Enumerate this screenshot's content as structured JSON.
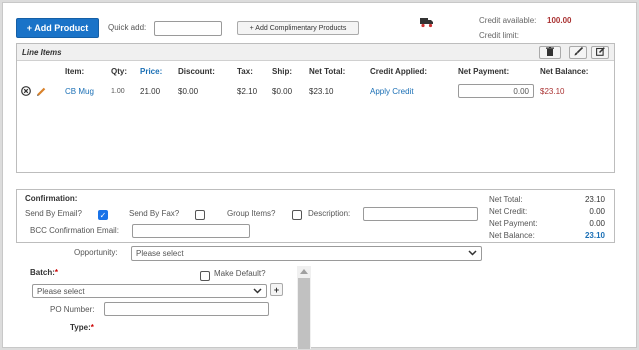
{
  "toolbar": {
    "add_product_label": "+ Add Product",
    "quick_add_label": "Quick add:",
    "quick_add_value": "",
    "add_complimentary_label": "+ Add Complimentary Products"
  },
  "credit": {
    "available_label": "Credit available:",
    "available_value": "100.00",
    "limit_label": "Credit limit:",
    "limit_value": ""
  },
  "line_items": {
    "title": "Line Items",
    "columns": [
      "Item:",
      "Qty:",
      "Price:",
      "Discount:",
      "Tax:",
      "Ship:",
      "Net Total:",
      "Credit Applied:",
      "Net Payment:",
      "Net Balance:"
    ],
    "rows": [
      {
        "item": "CB Mug",
        "qty": "1.00",
        "price": "21.00",
        "discount": "$0.00",
        "tax": "$2.10",
        "ship": "$0.00",
        "net_total": "$23.10",
        "credit_applied": "Apply Credit",
        "net_payment": "0.00",
        "net_balance": "$23.10"
      }
    ]
  },
  "confirmation": {
    "title": "Confirmation:",
    "send_email_label": "Send By Email?",
    "send_email_checked": true,
    "send_fax_label": "Send By Fax?",
    "send_fax_checked": false,
    "group_items_label": "Group Items?",
    "group_items_checked": false,
    "description_label": "Description:",
    "description_value": "",
    "bcc_label": "BCC Confirmation Email:",
    "bcc_value": ""
  },
  "summary": {
    "net_total_label": "Net Total:",
    "net_total_value": "23.10",
    "net_credit_label": "Net Credit:",
    "net_credit_value": "0.00",
    "net_payment_label": "Net Payment:",
    "net_payment_value": "0.00",
    "net_balance_label": "Net Balance:",
    "net_balance_value": "23.10"
  },
  "opportunity": {
    "label": "Opportunity:",
    "value": "Please select"
  },
  "batch": {
    "label": "Batch:",
    "value": "Please select",
    "make_default_label": "Make Default?",
    "add_label": "+"
  },
  "po": {
    "label": "PO Number:",
    "value": ""
  },
  "type": {
    "label": "Type:"
  },
  "colors": {
    "primary": "#1a73c8",
    "link": "#1a6fb5",
    "credit_red": "#a33333"
  }
}
